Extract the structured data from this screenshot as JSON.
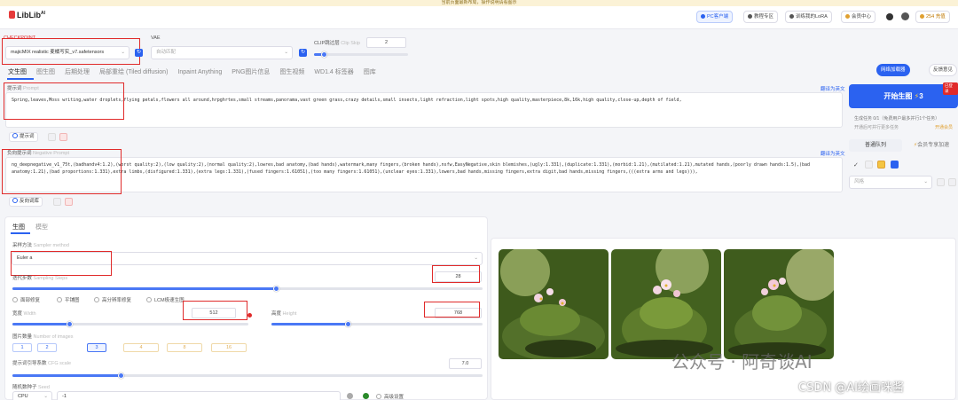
{
  "banner": {
    "text": "当前页面最新布局，操作说明请看图示"
  },
  "header": {
    "logo_text": "LibLib",
    "logo_sup": "AI",
    "buttons": [
      {
        "label": "PC客户端",
        "icon": "monitor-icon"
      },
      {
        "label": "教程专区",
        "icon": "book-icon"
      },
      {
        "label": "训练我的LoRA",
        "icon": "train-icon"
      },
      {
        "label": "会员中心",
        "icon": "crown-icon"
      }
    ],
    "points": "254 充值"
  },
  "checkpoint": {
    "label": "CHECKPOINT",
    "value": "majicMIX realistic 麦橘写实_v7.safetensors"
  },
  "vae": {
    "label": "VAE",
    "value": "自动匹配"
  },
  "clip": {
    "label": "CLIP跳过层",
    "label_en": "Clip Skip",
    "value": "2",
    "fill": 0.1
  },
  "tabs": [
    "文生图",
    "图生图",
    "后期处理",
    "局部重绘 (Tiled diffusion)",
    "Inpaint Anything",
    "PNG图片信息",
    "图生视频",
    "WD1.4 标签器",
    "图库"
  ],
  "right_actions": {
    "shortcut": "网络加载器",
    "feedback": "反馈意见"
  },
  "prompt": {
    "label": "提示词",
    "label_en": "Prompt",
    "translate": "翻译为英文",
    "text": "Spring,leaves,Moss writing,water droplets,flying petals,flowers all around,hrpghrtes,small streams,panorama,vast green grass,crazy details,small insects,light refraction,light spots,high quality,masterpiece,8k,16k,high quality,close-up,depth of field,",
    "lib_button": "提示词"
  },
  "negative": {
    "label": "负向提示词",
    "label_en": "Negative Prompt",
    "translate": "翻译为英文",
    "text": "ng_deepnegative_v1_75t,(badhandv4:1.2),(worst quality:2),(low quality:2),(normal quality:2),lowres,bad anatomy,(bad hands),watermark,many fingers,(broken hands),nsfw,EasyNegative,skin blemishes,(ugly:1.331),(duplicate:1.331),(morbid:1.21),(mutilated:1.21),mutated hands,(poorly drawn hands:1.5),(bad anatomy:1.21),(bad proportions:1.331),extra limbs,(disfigured:1.331),(extra legs:1.331),(fused fingers:1.61051),(too many fingers:1.61051),(unclear eyes:1.331),lowers,bad hands,missing fingers,extra digit,bad hands,missing fingers,(((extra arms and legs))),",
    "lib_button": "反向词库"
  },
  "gen_panel": {
    "button": "开始生图",
    "points_badge": "3",
    "corner_badge": "已登录",
    "info1": "生成任务 0/1（免费用户最多并行1个任务）",
    "info1_link": "开通会员",
    "info2": "开通后可并行更多任务",
    "queue_tab": "普通队列",
    "vip_tab": "会员专享加速",
    "style_placeholder": "风格"
  },
  "subtabs": [
    "生图",
    "模型"
  ],
  "sampler": {
    "label": "采样方法",
    "label_en": "Sampler method",
    "value": "Euler a"
  },
  "steps": {
    "label": "迭代步数",
    "label_en": "Sampling Steps",
    "value": "28",
    "fill": 0.56
  },
  "options": [
    "面部修复",
    "平铺图",
    "高分辨率修复",
    "LCM极速生图"
  ],
  "width": {
    "label": "宽度",
    "label_en": "Width",
    "value": "512",
    "fill": 0.24
  },
  "height": {
    "label": "高度",
    "label_en": "Height",
    "value": "768",
    "fill": 0.36
  },
  "img_count": {
    "label": "图片数量",
    "label_en": "Number of images",
    "options": [
      "1",
      "2",
      "3",
      "4",
      "8",
      "16"
    ],
    "selected": 2
  },
  "cfg": {
    "label": "提示词引导系数",
    "label_en": "CFG scale",
    "value": "7.0",
    "fill": 0.23
  },
  "seed": {
    "label": "随机数种子",
    "label_en": "Seed",
    "device": "CPU",
    "value": "-1",
    "hires": "高级设置"
  },
  "watermark": {
    "line1": "公众号 · 阿奇谈AI",
    "line2": "CSDN @AI绘画咪酱"
  }
}
